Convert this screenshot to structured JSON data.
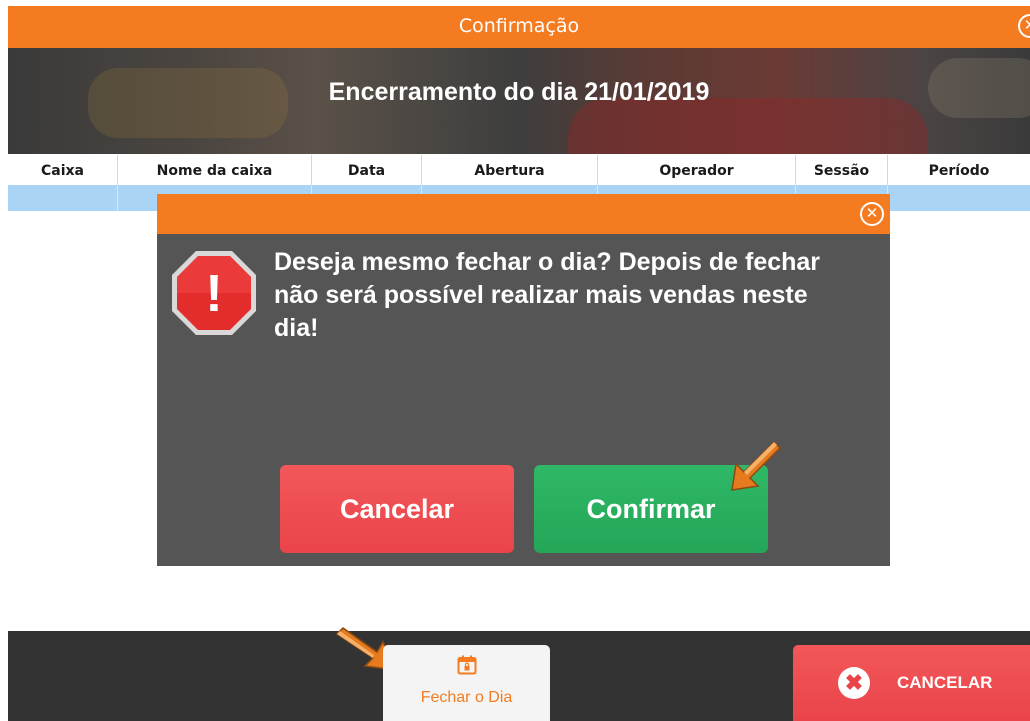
{
  "window": {
    "title": "Confirmação",
    "close_glyph": "✕"
  },
  "banner": {
    "heading": "Encerramento do dia  21/01/2019"
  },
  "table": {
    "columns": [
      "Caixa",
      "Nome da caixa",
      "Data",
      "Abertura",
      "Operador",
      "Sessão",
      "Período"
    ],
    "selected_row_color": "#a9d4f5"
  },
  "dialog": {
    "close_glyph": "✕",
    "icon": "stop-warning-icon",
    "icon_glyph": "!",
    "message": "Deseja mesmo fechar o dia? Depois de fechar não será possível realizar mais vendas neste dia!",
    "cancel_label": "Cancelar",
    "confirm_label": "Confirmar"
  },
  "footer": {
    "fechar_icon": "calendar-lock-icon",
    "fechar_label": "Fechar o Dia",
    "cancelar_glyph": "✖",
    "cancelar_label": "CANCELAR"
  },
  "colors": {
    "accent": "#f47b20",
    "danger": "#e94449",
    "success": "#25a658",
    "dialog_bg": "#555555",
    "footer_bg": "#333333"
  }
}
